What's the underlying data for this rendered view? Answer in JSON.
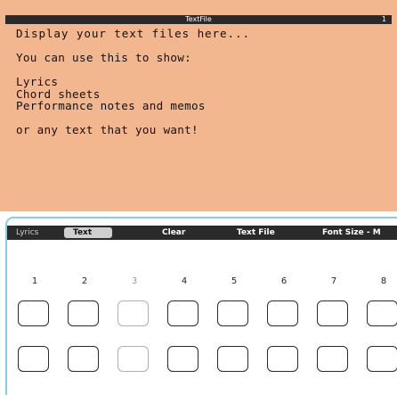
{
  "text_file": {
    "title": "TextFile",
    "page_number": "1",
    "lines": [
      "Display your text files here...",
      "",
      "You can use this to show:",
      "",
      "Lyrics",
      "Chord sheets",
      "Performance notes and memos",
      "",
      "or any text that you want!"
    ]
  },
  "controls": {
    "tabs": [
      "Lyrics",
      "Text"
    ],
    "selected_tab": "Text",
    "clear_label": "Clear",
    "text_file_label": "Text File",
    "font_size_label": "Font Size - M"
  },
  "pads": {
    "numbers": [
      "1",
      "2",
      "3",
      "4",
      "5",
      "6",
      "7",
      "8"
    ],
    "disabled": [
      "3"
    ]
  },
  "colors": {
    "text_background": "#f2b78e",
    "bar_background": "#2a2a2a",
    "panel_border": "#8ccbe6"
  }
}
